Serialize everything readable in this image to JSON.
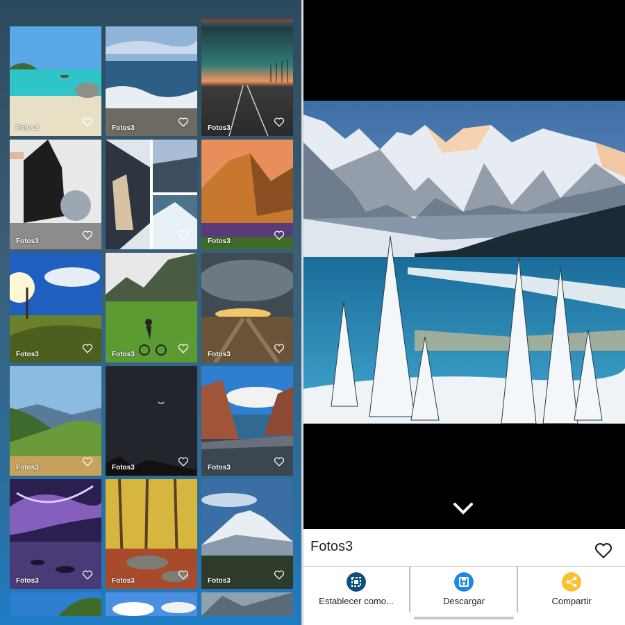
{
  "gallery": {
    "tile_label": "Fotos3",
    "tiles": [
      {
        "name": "beach"
      },
      {
        "name": "ocean-waves"
      },
      {
        "name": "desert-road-sunset"
      },
      {
        "name": "bw-collage"
      },
      {
        "name": "winter-collage"
      },
      {
        "name": "sunset-mountain"
      },
      {
        "name": "sunny-hill"
      },
      {
        "name": "mountain-biker"
      },
      {
        "name": "stormy-field"
      },
      {
        "name": "green-valley"
      },
      {
        "name": "night-moon"
      },
      {
        "name": "canyon-lake"
      },
      {
        "name": "aurora"
      },
      {
        "name": "autumn-forest"
      },
      {
        "name": "snowy-volcano"
      }
    ]
  },
  "viewer": {
    "photo": "snowy-lake-mountains",
    "sheet_title": "Fotos3",
    "actions": [
      {
        "label": "Establecer como...",
        "icon": "set-as-icon",
        "color": "#0d4f7a"
      },
      {
        "label": "Descargar",
        "icon": "download-icon",
        "color": "#1e88e5"
      },
      {
        "label": "Compartir",
        "icon": "share-icon",
        "color": "#fbc02d"
      }
    ]
  }
}
